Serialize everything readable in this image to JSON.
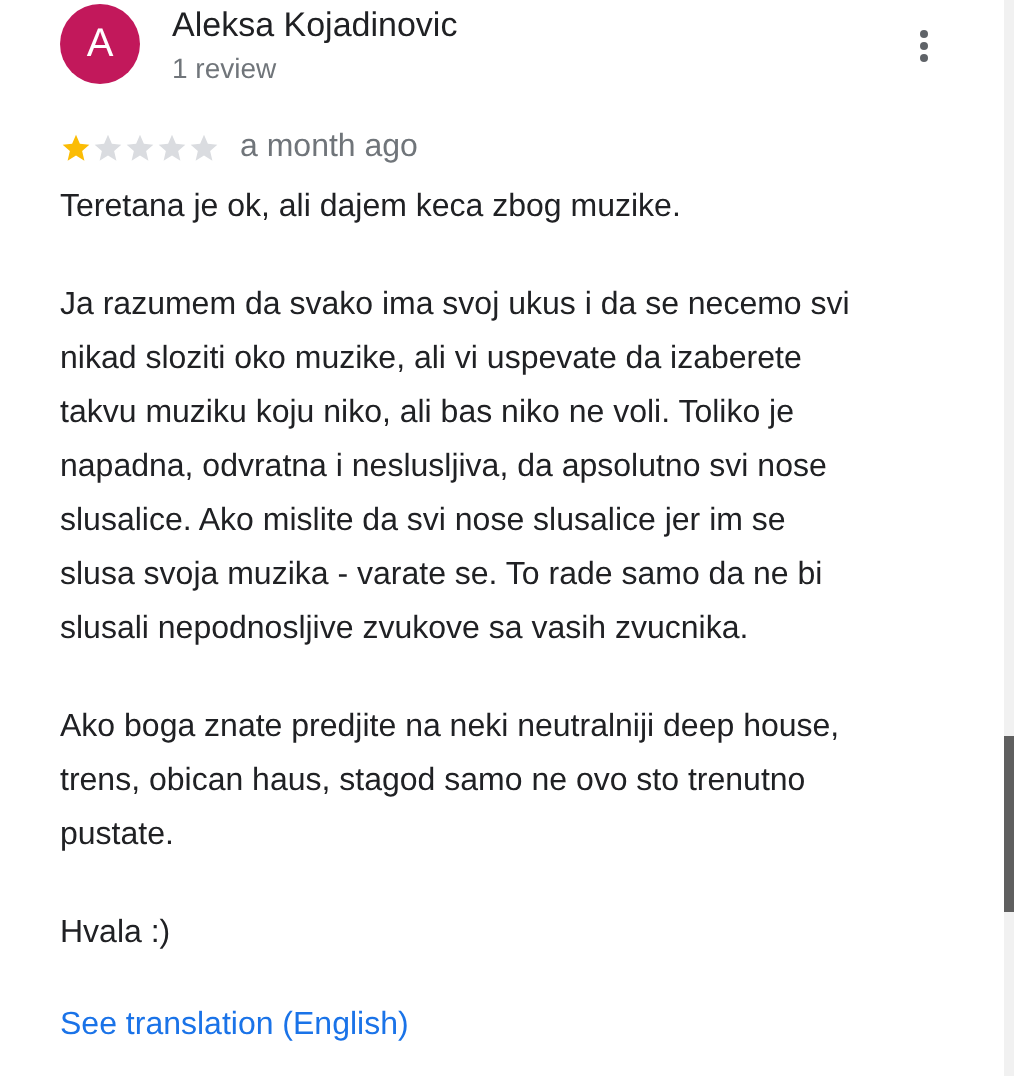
{
  "review": {
    "author": {
      "initial": "A",
      "name": "Aleksa Kojadinovic",
      "subtitle": "1 review"
    },
    "stars": 1,
    "time": "a month ago",
    "paragraphs": [
      "Teretana je ok, ali dajem keca zbog muzike.",
      "Ja razumem da svako ima svoj ukus i da se necemo svi\nnikad sloziti oko muzike, ali vi uspevate da izaberete\ntakvu muziku koju niko, ali bas niko ne voli. Toliko je\nnapadna, odvratna i neslusljiva, da apsolutno svi nose\nslusalice. Ako mislite da svi nose slusalice jer im se\nslusa svoja muzika - varate se. To rade samo da ne bi\nslusali nepodnosljive zvukove sa vasih zvucnika.",
      "Ako boga znate predjite na neki neutralniji deep house,\ntrens, obican haus, stagod samo ne ovo sto trenutno\npustate.",
      "Hvala :)"
    ],
    "translate_link": "See translation (English)"
  }
}
